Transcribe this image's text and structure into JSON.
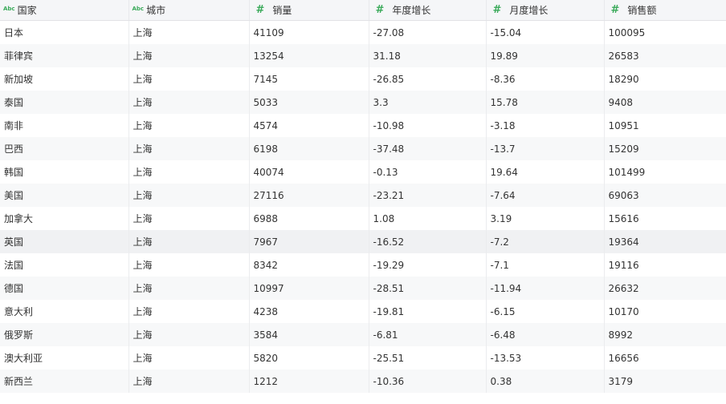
{
  "table": {
    "columns": [
      {
        "label": "国家",
        "type": "Abc",
        "type_icon": "text-type-icon"
      },
      {
        "label": "城市",
        "type": "Abc",
        "type_icon": "text-type-icon"
      },
      {
        "label": "销量",
        "type": "#",
        "type_icon": "number-type-icon"
      },
      {
        "label": "年度增长",
        "type": "#",
        "type_icon": "number-type-icon"
      },
      {
        "label": "月度增长",
        "type": "#",
        "type_icon": "number-type-icon"
      },
      {
        "label": "销售额",
        "type": "#",
        "type_icon": "number-type-icon"
      }
    ],
    "rows": [
      [
        "日本",
        "上海",
        "41109",
        "-27.08",
        "-15.04",
        "100095"
      ],
      [
        "菲律宾",
        "上海",
        "13254",
        "31.18",
        "19.89",
        "26583"
      ],
      [
        "新加坡",
        "上海",
        "7145",
        "-26.85",
        "-8.36",
        "18290"
      ],
      [
        "泰国",
        "上海",
        "5033",
        "3.3",
        "15.78",
        "9408"
      ],
      [
        "南非",
        "上海",
        "4574",
        "-10.98",
        "-3.18",
        "10951"
      ],
      [
        "巴西",
        "上海",
        "6198",
        "-37.48",
        "-13.7",
        "15209"
      ],
      [
        "韩国",
        "上海",
        "40074",
        "-0.13",
        "19.64",
        "101499"
      ],
      [
        "美国",
        "上海",
        "27116",
        "-23.21",
        "-7.64",
        "69063"
      ],
      [
        "加拿大",
        "上海",
        "6988",
        "1.08",
        "3.19",
        "15616"
      ],
      [
        "英国",
        "上海",
        "7967",
        "-16.52",
        "-7.2",
        "19364"
      ],
      [
        "法国",
        "上海",
        "8342",
        "-19.29",
        "-7.1",
        "19116"
      ],
      [
        "德国",
        "上海",
        "10997",
        "-28.51",
        "-11.94",
        "26632"
      ],
      [
        "意大利",
        "上海",
        "4238",
        "-19.81",
        "-6.15",
        "10170"
      ],
      [
        "俄罗斯",
        "上海",
        "3584",
        "-6.81",
        "-6.48",
        "8992"
      ],
      [
        "澳大利亚",
        "上海",
        "5820",
        "-25.51",
        "-13.53",
        "16656"
      ],
      [
        "新西兰",
        "上海",
        "1212",
        "-10.36",
        "0.38",
        "3179"
      ]
    ],
    "highlighted_row": 9
  },
  "colors": {
    "type_icon": "#3aaa5a",
    "header_bg": "#f5f6f8",
    "stripe_bg": "#f7f8f9",
    "highlight_bg": "#f0f1f3"
  }
}
